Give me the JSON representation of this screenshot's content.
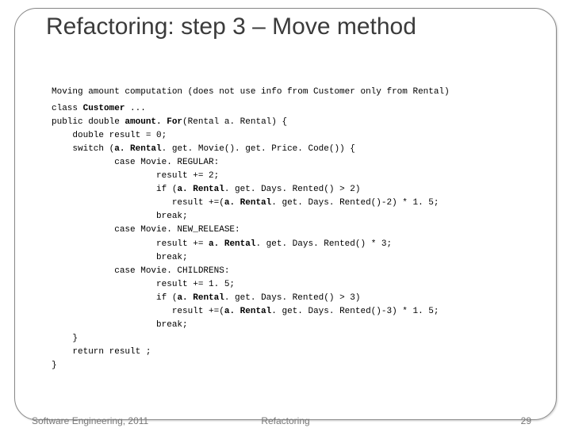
{
  "title": "Refactoring: step 3 – Move method",
  "description": "Moving amount computation (does not use info from Customer only from Rental)",
  "code": {
    "l1a": "class ",
    "l1b": "Customer",
    "l1c": " ...",
    "l2a": "public double ",
    "l2b": "amount. For",
    "l2c": "(Rental a. Rental) {",
    "l3": "    double result = 0;",
    "l4a": "    switch (",
    "l4b": "a. Rental",
    "l4c": ". get. Movie(). get. Price. Code()) {",
    "l5": "            case Movie. REGULAR:",
    "l6": "                    result += 2;",
    "l7a": "                    if (",
    "l7b": "a. Rental",
    "l7c": ". get. Days. Rented() > 2)",
    "l8a": "                       result +=(",
    "l8b": "a. Rental",
    "l8c": ". get. Days. Rented()-2) * 1. 5;",
    "l9": "                    break;",
    "l10": "            case Movie. NEW_RELEASE:",
    "l11a": "                    result += ",
    "l11b": "a. Rental",
    "l11c": ". get. Days. Rented() * 3;",
    "l12": "                    break;",
    "l13": "            case Movie. CHILDRENS:",
    "l14": "                    result += 1. 5;",
    "l15a": "                    if (",
    "l15b": "a. Rental",
    "l15c": ". get. Days. Rented() > 3)",
    "l16a": "                       result +=(",
    "l16b": "a. Rental",
    "l16c": ". get. Days. Rented()-3) * 1. 5;",
    "l17": "                    break;",
    "l18": "    }",
    "l19": "    return result ;",
    "l20": "}"
  },
  "footer": {
    "left": "Software Engineering, 2011",
    "center": "Refactoring",
    "right": "29"
  }
}
